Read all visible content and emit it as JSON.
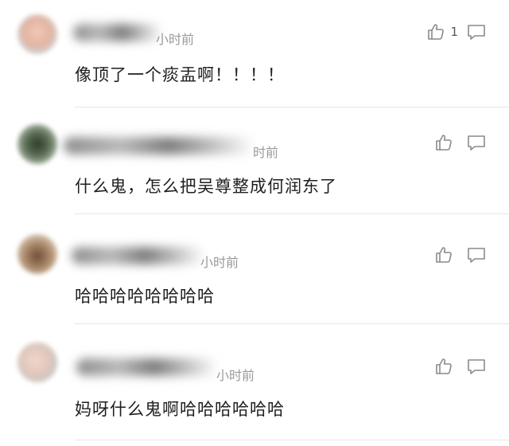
{
  "comments": [
    {
      "time": "小时前",
      "text": "像顶了一个痰盂啊！！！！",
      "likes": "1",
      "avatar_color": "#e3b4a2"
    },
    {
      "time": "时前",
      "text": "什么鬼，怎么把吴尊整成何润东了",
      "likes": "",
      "avatar_color": "#5a6b52"
    },
    {
      "time": "小时前",
      "text": "哈哈哈哈哈哈哈哈",
      "likes": "",
      "avatar_color": "#a78566"
    },
    {
      "time": "小时前",
      "text": "妈呀什么鬼啊哈哈哈哈哈哈",
      "likes": "",
      "avatar_color": "#e2c8bd"
    }
  ],
  "icons": {
    "like": "thumbs-up-icon",
    "reply": "comment-bubble-icon"
  },
  "colors": {
    "text": "#1e1e1e",
    "muted": "#9a9a9a",
    "icon": "#8a8a8a",
    "divider": "#e6e6e6"
  }
}
